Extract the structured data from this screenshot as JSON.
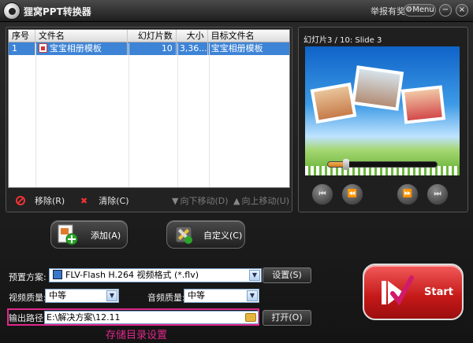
{
  "titlebar": {
    "app_title": "狸窝PPT转换器",
    "report_link": "举报有奖",
    "menu_label": "Menu",
    "minimize_glyph": "−",
    "close_glyph": "×"
  },
  "file_list": {
    "columns": [
      "序号",
      "文件名",
      "幻灯片数",
      "大小",
      "目标文件名"
    ],
    "rows": [
      {
        "index": "1",
        "filename": "宝宝相册模板",
        "slides": "10",
        "size": "3,36...",
        "target": "宝宝相册模板"
      }
    ],
    "actions": {
      "remove": "移除(R)",
      "clear": "清除(C)",
      "move_down": "向下移动(D)",
      "move_up": "向上移动(U)"
    }
  },
  "preview": {
    "slide_info": "幻灯片3 / 10: Slide 3",
    "progress": 0.15,
    "buttons": [
      "⏮",
      "⏪",
      "⏩",
      "⏭"
    ]
  },
  "buttons": {
    "add": "添加(A)",
    "custom": "自定义(C)",
    "settings": "设置(S)",
    "open": "打开(O)",
    "start": "Start"
  },
  "settings": {
    "preset_label": "预置方案:",
    "preset_value": "FLV-Flash H.264 视频格式 (*.flv)",
    "video_quality_label": "视频质量:",
    "video_quality_value": "中等",
    "audio_quality_label": "音频质量:",
    "audio_quality_value": "中等",
    "output_path_label": "输出路径:",
    "output_path_value": "E:\\解决方案\\12.11",
    "annotation": "存储目录设置"
  },
  "colors": {
    "accent_selection": "#3d83d6",
    "highlight_annotation": "#e0288c",
    "start_red": "#c41818"
  }
}
